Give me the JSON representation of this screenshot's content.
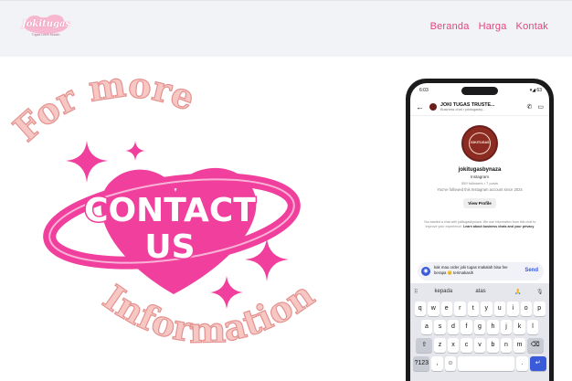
{
  "header": {
    "logo_name": "Jokitugas",
    "logo_tagline": "Tugas Lebih Mudah",
    "nav": [
      "Beranda",
      "Harga",
      "Kontak"
    ]
  },
  "hero": {
    "top_caption": "For more",
    "title_line1": "CONTACT",
    "title_line2": "US",
    "bottom_caption": "Information"
  },
  "phone": {
    "status_time": "6:03",
    "status_right": "▾◢ 63",
    "chat_title": "JOKI TUGAS TRUSTE...",
    "chat_subtitle": "Business chat • jokitugasby...",
    "avatar_label": "JOKITUGAS",
    "profile_name": "jokitugasbynaza",
    "profile_platform": "Instagram",
    "profile_stats": "559 followers • 7 posts",
    "profile_followed": "You've followed this Instagram account since 2024",
    "view_profile_label": "View Profile",
    "info_text": "You started a chat with jokitugasbynaza. We use information from this chat to improve your experience.",
    "info_link": "Learn about business chats and your privacy",
    "message_text": "kak mau order joki tugas makalah bisa fee berapa 😊 terimakasih",
    "send_label": "Send",
    "suggestions": [
      "kepada",
      "atas",
      "🙏"
    ],
    "keyboard_rows": [
      [
        "q",
        "w",
        "e",
        "r",
        "t",
        "y",
        "u",
        "i",
        "o",
        "p"
      ],
      [
        "a",
        "s",
        "d",
        "f",
        "g",
        "h",
        "j",
        "k",
        "l"
      ],
      [
        "⇧",
        "z",
        "x",
        "c",
        "v",
        "b",
        "n",
        "m",
        "⌫"
      ],
      [
        "?123",
        ",",
        "☺",
        "",
        ".",
        " ↵"
      ]
    ]
  },
  "colors": {
    "accent": "#e2447f",
    "star": "#f03f9c",
    "caption": "#f7c7c4",
    "keyboard_enter": "#3a5bd9"
  }
}
